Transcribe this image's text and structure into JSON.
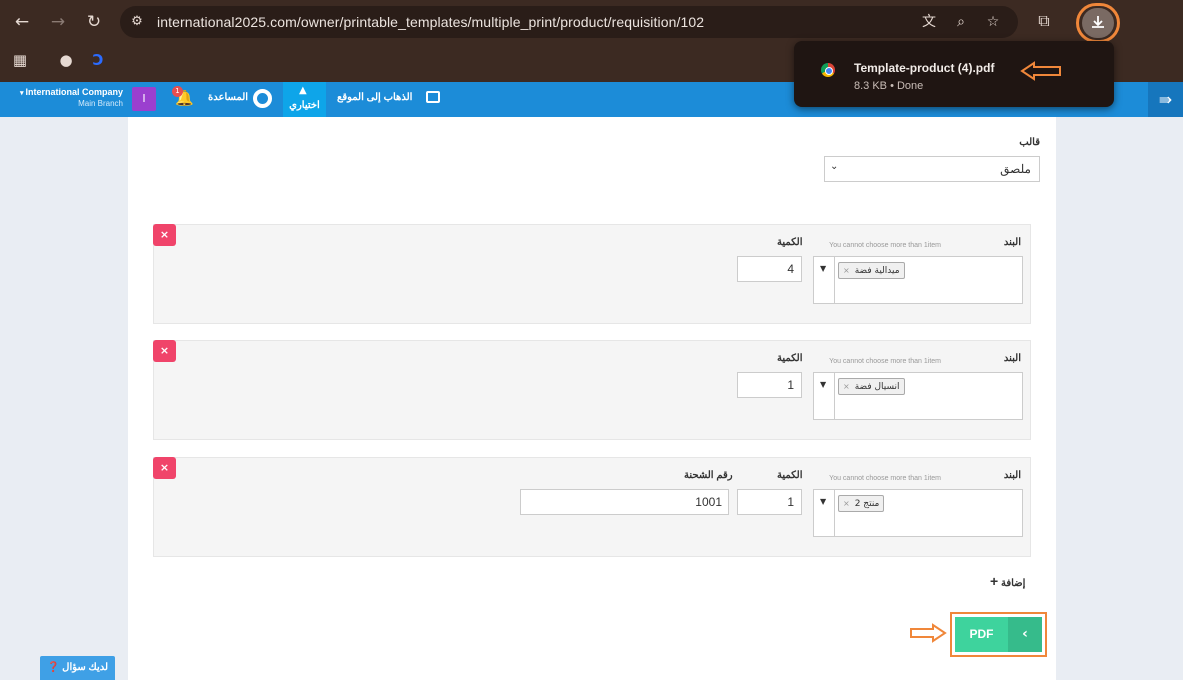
{
  "browser": {
    "url": "international2025.com/owner/printable_templates/multiple_print/product/requisition/102"
  },
  "download": {
    "filename": "Template-product (4).pdf",
    "meta": "8.3 KB • Done"
  },
  "header": {
    "company": "International Company",
    "branch": "Main Branch",
    "avatar_letter": "I",
    "notification_count": "1",
    "help": "المساعدة",
    "shortcut": "اختياري",
    "goto_site": "الذهاب إلى الموقع"
  },
  "form": {
    "template_label": "قالب",
    "template_value": "ملصق",
    "item_label": "البند",
    "item_hint": "You cannot choose more than 1item",
    "quantity_label": "الكمية",
    "shipment_label": "رقم الشحنة",
    "rows": [
      {
        "item": "ميدالية فضة",
        "quantity": "4"
      },
      {
        "item": "انسيال فضة",
        "quantity": "1"
      },
      {
        "item": "منتج 2",
        "quantity": "1",
        "shipment": "1001"
      }
    ],
    "add_label": "إضافة",
    "pdf_label": "PDF"
  },
  "help_widget": {
    "label": "لديك سؤال"
  },
  "colors": {
    "header": "#1c8cd8",
    "pdf": "#3ed39d",
    "highlight": "#f0873a",
    "remove": "#f0446a"
  }
}
